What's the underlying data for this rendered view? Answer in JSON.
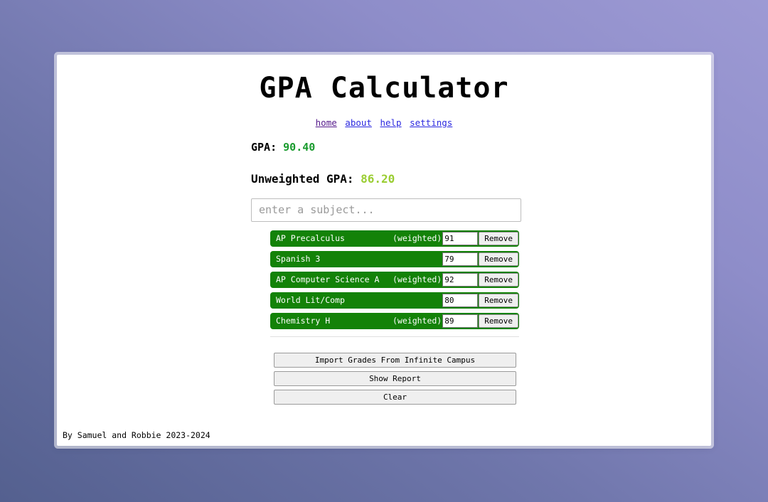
{
  "app": {
    "title": "GPA Calculator"
  },
  "nav": {
    "items": [
      {
        "label": "home",
        "state": "visited"
      },
      {
        "label": "about",
        "state": "unvisited"
      },
      {
        "label": "help",
        "state": "unvisited"
      },
      {
        "label": "settings",
        "state": "unvisited"
      }
    ]
  },
  "gpa": {
    "weighted_label": "GPA:",
    "weighted_value": "90.40",
    "weighted_color": "#1a9b2e",
    "unweighted_label": "Unweighted GPA:",
    "unweighted_value": "86.20",
    "unweighted_color": "#9acd32"
  },
  "subject_entry": {
    "placeholder": "enter a subject...",
    "value": ""
  },
  "subjects": {
    "weighted_tag": "(weighted)",
    "remove_label": "Remove",
    "row_color": "#138208",
    "items": [
      {
        "name": "AP Precalculus",
        "weighted": true,
        "grade": "91"
      },
      {
        "name": "Spanish 3",
        "weighted": false,
        "grade": "79"
      },
      {
        "name": "AP Computer Science A",
        "weighted": true,
        "grade": "92"
      },
      {
        "name": "World Lit/Comp",
        "weighted": false,
        "grade": "80"
      },
      {
        "name": "Chemistry H",
        "weighted": true,
        "grade": "89"
      }
    ]
  },
  "actions": {
    "import_label": "Import Grades From Infinite Campus",
    "report_label": "Show Report",
    "clear_label": "Clear"
  },
  "footer": {
    "text": "By Samuel and Robbie 2023-2024"
  }
}
